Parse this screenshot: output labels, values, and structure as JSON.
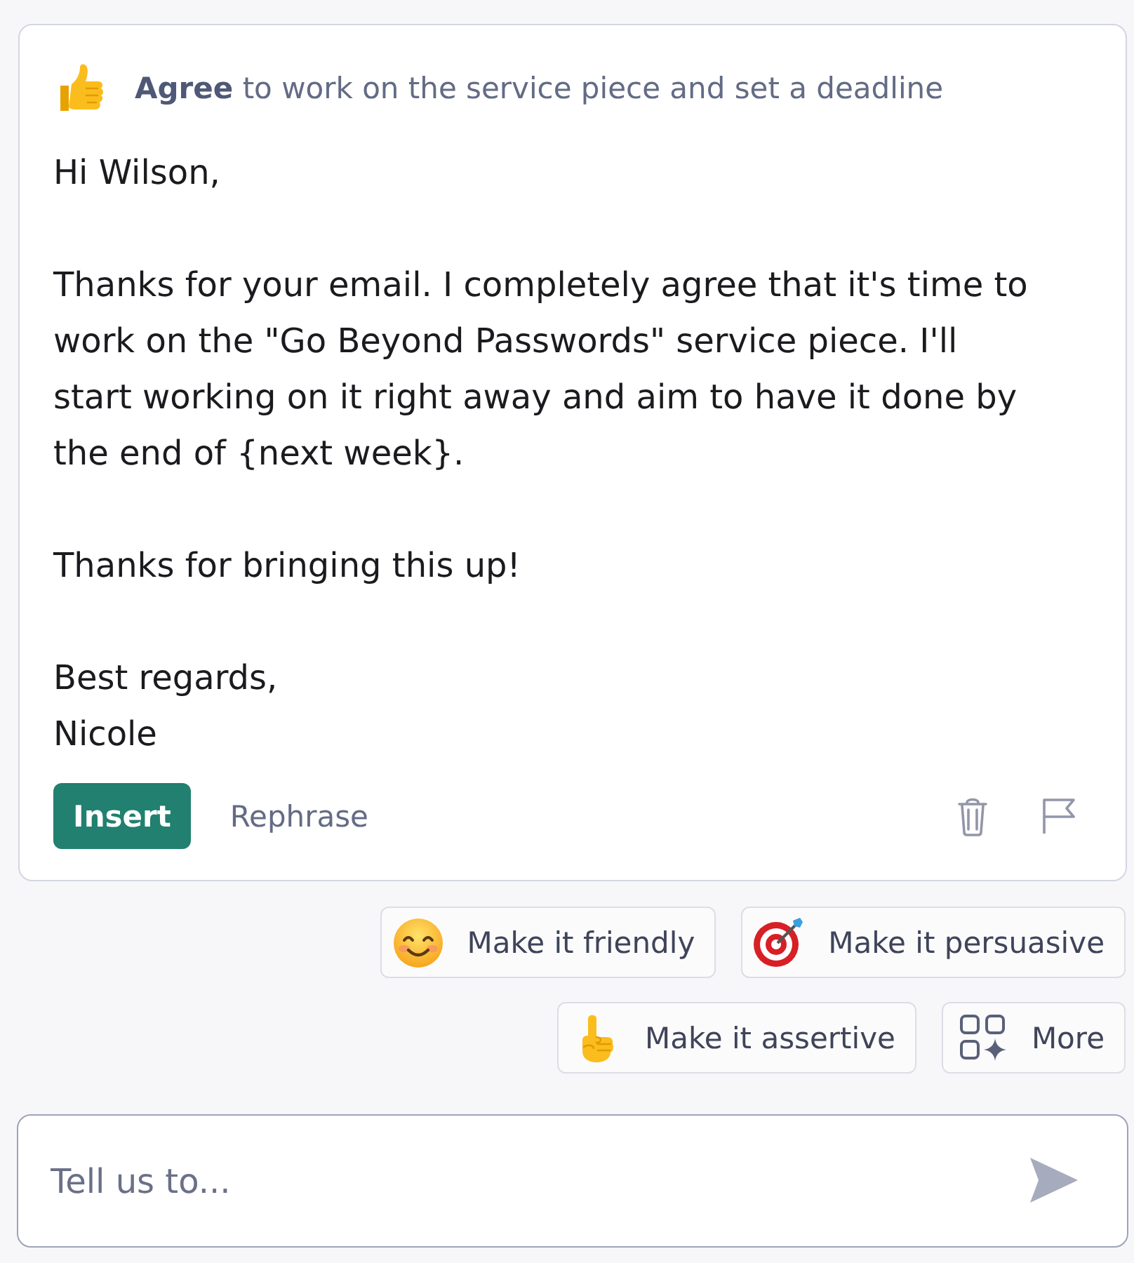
{
  "suggestion": {
    "title": "**Agree** to work on the service piece and set a deadline"
  },
  "message": {
    "paragraphs": [
      {
        "lines": [
          "Hi Wilson,"
        ]
      },
      {
        "lines": [
          "Thanks for your email. I completely agree that it's time to work on the \"Go Beyond Passwords\" service piece. I'll start working on it right away and aim to have it done by the end of {next week}."
        ]
      },
      {
        "lines": [
          "Thanks for bringing this up!"
        ]
      },
      {
        "lines": [
          "Best regards,",
          "Nicole"
        ]
      }
    ]
  },
  "actions": [
    {
      "label": "Insert",
      "kind": "primary"
    },
    {
      "label": "Rephrase",
      "kind": "text"
    }
  ],
  "quick_actions": [
    {
      "label": "Make it friendly"
    },
    {
      "label": "Make it persuasive"
    },
    {
      "label": "Make it assertive"
    },
    {
      "label": "More"
    }
  ],
  "composer": {
    "placeholder": "Tell us to..."
  }
}
